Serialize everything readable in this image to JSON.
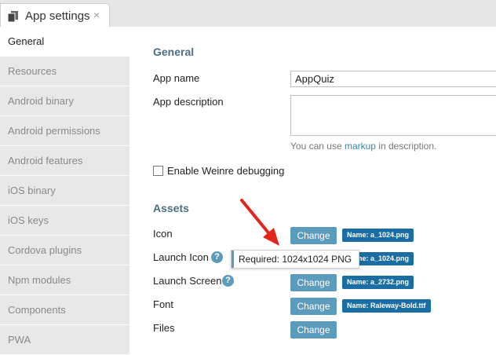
{
  "tab": {
    "title": "App settings",
    "close": "×",
    "icon": "document-icon"
  },
  "sidebar": {
    "items": [
      {
        "label": "General",
        "active": true
      },
      {
        "label": "Resources"
      },
      {
        "label": "Android binary"
      },
      {
        "label": "Android permissions"
      },
      {
        "label": "Android features"
      },
      {
        "label": "iOS binary"
      },
      {
        "label": "iOS keys"
      },
      {
        "label": "Cordova plugins"
      },
      {
        "label": "Npm modules"
      },
      {
        "label": "Components"
      },
      {
        "label": "PWA"
      }
    ]
  },
  "general": {
    "heading": "General",
    "app_name_label": "App name",
    "app_name_value": "AppQuiz",
    "app_description_label": "App description",
    "hint_prefix": "You can use ",
    "hint_link": "markup",
    "hint_suffix": " in description.",
    "weinre_label": "Enable Weinre debugging"
  },
  "assets": {
    "heading": "Assets",
    "change_label": "Change",
    "help_glyph": "?",
    "rows": [
      {
        "label": "Icon",
        "badge": "Name: a_1024.png"
      },
      {
        "label": "Launch Icon",
        "badge": "Name: a_1024.png"
      },
      {
        "label": "Launch Screen",
        "badge": "Name: a_2732.png"
      },
      {
        "label": "Font",
        "badge": "Name: Raleway-Bold.ttf"
      },
      {
        "label": "Files"
      }
    ]
  },
  "tooltip": {
    "text": "Required: 1024x1024 PNG"
  },
  "colors": {
    "accent": "#5b9bbb",
    "badge": "#1a6ea3",
    "heading": "#4b6e82",
    "arrow": "#e3241b"
  }
}
